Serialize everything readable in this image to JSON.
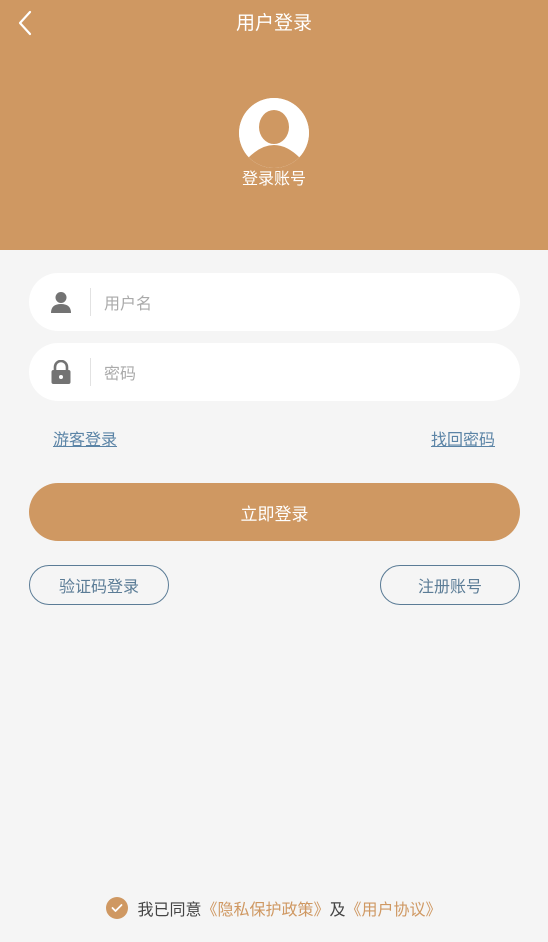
{
  "header": {
    "title": "用户登录",
    "avatar_label": "登录账号"
  },
  "form": {
    "username_placeholder": "用户名",
    "password_placeholder": "密码"
  },
  "links": {
    "guest_login": "游客登录",
    "forgot_password": "找回密码"
  },
  "buttons": {
    "login": "立即登录",
    "sms_login": "验证码登录",
    "register": "注册账号"
  },
  "agreement": {
    "prefix": "我已同意",
    "privacy": "《隐私保护政策》",
    "and": "及",
    "user_agreement": "《用户协议》"
  },
  "colors": {
    "accent": "#cf9862",
    "link": "#5b84a6"
  }
}
